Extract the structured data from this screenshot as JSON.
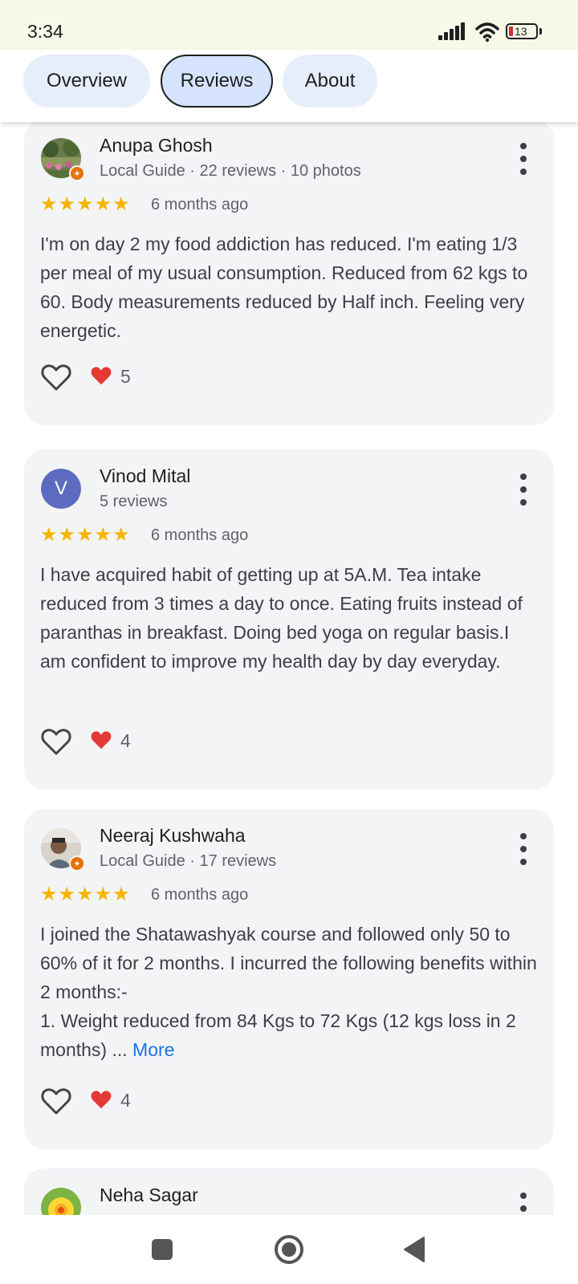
{
  "status_bar": {
    "time": "3:34",
    "battery_level": "13"
  },
  "tabs": [
    {
      "label": "Overview",
      "selected": false
    },
    {
      "label": "Reviews",
      "selected": true
    },
    {
      "label": "About",
      "selected": false
    }
  ],
  "reviews": [
    {
      "name": "Anupa Ghosh",
      "meta": "Local Guide · 22 reviews · 10 photos",
      "local_guide": true,
      "rating": 5,
      "stars": "★★★★★",
      "time": "6 months ago",
      "text": "I'm on day 2 my food addiction has reduced. I'm eating 1/3 per meal of my usual consumption. Reduced from 62 kgs to 60. Body measurements reduced by Half inch. Feeling very energetic.",
      "likes": "5"
    },
    {
      "name": "Vinod Mital",
      "meta": "5 reviews",
      "avatar_letter": "V",
      "local_guide": false,
      "rating": 5,
      "stars": "★★★★★",
      "time": "6 months ago",
      "text": "I have acquired habit of getting up at 5A.M. Tea intake reduced from 3 times a day to once. Eating fruits instead of paranthas in breakfast. Doing bed yoga on regular basis.I am confident to improve my health day by day everyday.",
      "likes": "4"
    },
    {
      "name": "Neeraj Kushwaha",
      "meta": "Local Guide · 17 reviews",
      "local_guide": true,
      "rating": 5,
      "stars": "★★★★★",
      "time": "6 months ago",
      "text_lines": [
        "I joined the Shatawashyak course and followed only 50 to 60% of it for 2 months. I incurred the following benefits within 2 months:-",
        "1. Weight reduced from 84 Kgs to 72 Kgs (12 kgs loss in 2 months) ... "
      ],
      "more_label": "More",
      "likes": "4"
    },
    {
      "name": "Neha Sagar"
    }
  ],
  "colors": {
    "star": "#f4b400",
    "heart": "#e53935",
    "link": "#1a73e8",
    "card_bg": "#f3f4f6",
    "tab_bg": "#e6eefc",
    "status_bg": "#f6f8e8"
  },
  "icons": [
    "signal-icon",
    "wifi-icon",
    "battery-icon",
    "more-vert-icon",
    "heart-outline-icon",
    "heart-filled-icon",
    "local-guide-badge-icon",
    "recent-apps-icon",
    "home-icon",
    "back-icon"
  ]
}
